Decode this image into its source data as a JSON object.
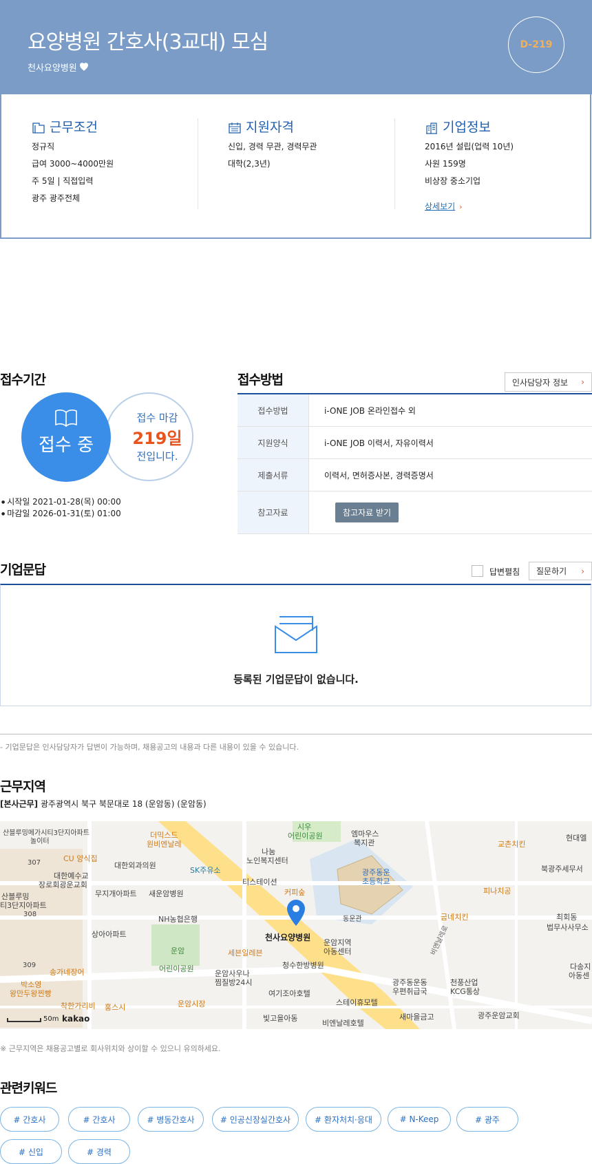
{
  "header": {
    "title": "요양병원 간호사(3교대) 모심",
    "company": "천사요양병원",
    "dday": "D-219"
  },
  "conditions": {
    "title": "근무조건",
    "lines": [
      "정규직",
      "급여 3000~4000만원",
      "주 5일 | 직접입력",
      "광주 광주전체"
    ]
  },
  "qualifications": {
    "title": "지원자격",
    "lines": [
      "신입, 경력 무관, 경력무관",
      "대학(2,3년)"
    ]
  },
  "company_info": {
    "title": "기업정보",
    "lines": [
      "2016년 설립(업력 10년)",
      "사원 159명",
      "비상장 중소기업"
    ],
    "detail_link": "상세보기"
  },
  "period": {
    "title": "접수기간",
    "status": "접수 중",
    "deadline_label": "접수 마감",
    "deadline_days": "219일",
    "deadline_suffix": "전입니다.",
    "start": "시작일 2021-01-28(목) 00:00",
    "end": "마감일 2026-01-31(토) 01:00"
  },
  "method": {
    "title": "접수방법",
    "hr_button": "인사담당자 정보",
    "rows": [
      {
        "label": "접수방법",
        "value": "i-ONE JOB 온라인접수 외"
      },
      {
        "label": "지원양식",
        "value": "i-ONE JOB 이력서, 자유이력서"
      },
      {
        "label": "제출서류",
        "value": "이력서, 면허증사본, 경력증명서"
      },
      {
        "label": "참고자료",
        "button": "참고자료 받기"
      }
    ]
  },
  "qna": {
    "title": "기업문답",
    "toggle_label": "답변펼침",
    "ask_button": "질문하기",
    "empty_text": "등록된 기업문답이 없습니다.",
    "note": "- 기업문답은 인사담당자가 답변이 가능하며, 채용공고의 내용과 다른 내용이 있을 수 있습니다."
  },
  "location": {
    "title": "근무지역",
    "prefix": "[본사근무]",
    "address": "광주광역시 북구 북문대로 18 (운암동) (운암동)",
    "note": "※ 근무지역은 채용공고별로 회사위치와 상이할 수 있으니 유의하세요."
  },
  "map": {
    "scale": "50m",
    "brand": "kakao",
    "marker_label": "천사요양병원",
    "labels": [
      "산블루밍메가시티3단지아파트",
      "놀이터",
      "더믹스드",
      "원비엔날레",
      "시우",
      "어린이공원",
      "엠마우스",
      "복지관",
      "교촌치킨",
      "현대엘",
      "307",
      "CU 양식집",
      "대한외과의원",
      "SK주유소",
      "나눔",
      "노인복지센터",
      "북광주세무서",
      "대한예수교",
      "장로회광운교회",
      "티스테이션",
      "커피숲",
      "광주동운",
      "초등학교",
      "피나치공",
      "산블루밍",
      "무지개아파트",
      "새운암병원",
      "티3단지아파트",
      "308",
      "NH농협은행",
      "동운관",
      "굽네치킨",
      "최회동",
      "법무사사무소",
      "상아아파트",
      "운암",
      "어린이공원",
      "세븐일레븐",
      "운암지역",
      "아동센터",
      "309",
      "송가네장어",
      "운암사우나",
      "찜질방24시",
      "청수한방병원",
      "광주동운동",
      "우편취급국",
      "천풍산업",
      "KCG통상",
      "박소영",
      "왕만두왕찐빵",
      "착한가리비",
      "홍스시",
      "운암시장",
      "여기조아호텔",
      "스테이휴모텔",
      "빛고을아동",
      "새마을금고",
      "광주운암교회",
      "비엔날레호텔",
      "다송지",
      "아동센",
      "비엔날레로"
    ]
  },
  "keywords": {
    "title": "관련키워드",
    "items": [
      "# 간호사",
      "# 간호사",
      "# 병동간호사",
      "# 인공신장실간호사",
      "# 환자처치·응대",
      "# N-Keep",
      "# 광주",
      "# 신입",
      "# 경력"
    ]
  },
  "colors": {
    "header_bg": "#7a9cc6",
    "accent_blue": "#1f5fb0",
    "status_circle": "#3a8ee8",
    "deadline_red": "#e8541e",
    "dday_orange": "#f2b05a"
  }
}
